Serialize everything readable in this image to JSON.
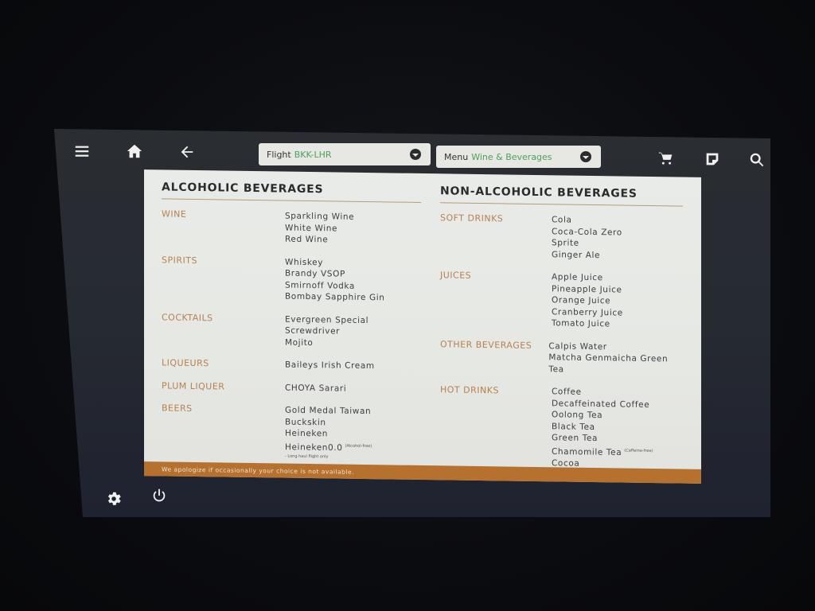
{
  "topbar": {
    "flight_dropdown": {
      "label": "Flight",
      "value": "BKK-LHR"
    },
    "menu_dropdown": {
      "label": "Menu",
      "value": "Wine & Beverages"
    },
    "icons": [
      "menu-icon",
      "home-icon",
      "back-arrow-icon",
      "cart-icon",
      "inbox-icon",
      "search-icon"
    ]
  },
  "alcoholic": {
    "title": "ALCOHOLIC BEVERAGES",
    "sections": [
      {
        "category": "WINE",
        "items": [
          "Sparkling Wine",
          "White Wine",
          "Red Wine"
        ]
      },
      {
        "category": "SPIRITS",
        "items": [
          "Whiskey",
          "Brandy VSOP",
          "Smirnoff Vodka",
          "Bombay Sapphire Gin"
        ]
      },
      {
        "category": "COCKTAILS",
        "items": [
          "Evergreen Special",
          "Screwdriver",
          "Mojito"
        ]
      },
      {
        "category": "LIQUEURS",
        "items": [
          "Baileys Irish Cream"
        ]
      },
      {
        "category": "PLUM LIQUER",
        "items": [
          "CHOYA Sarari"
        ]
      },
      {
        "category": "BEERS",
        "items": [
          "Gold Medal Taiwan",
          "Buckskin",
          "Heineken",
          "Heineken0.0"
        ],
        "item_note": "(Alcohol-free)",
        "footnote": "- Long haul flight only"
      }
    ]
  },
  "non_alcoholic": {
    "title": "NON-ALCOHOLIC BEVERAGES",
    "sections": [
      {
        "category": "SOFT DRINKS",
        "items": [
          "Cola",
          "Coca-Cola Zero",
          "Sprite",
          "Ginger Ale"
        ]
      },
      {
        "category": "JUICES",
        "items": [
          "Apple Juice",
          "Pineapple Juice",
          "Orange Juice",
          "Cranberry Juice",
          "Tomato Juice"
        ]
      },
      {
        "category": "OTHER BEVERAGES",
        "items": [
          "Calpis Water",
          "Matcha Genmaicha Green Tea"
        ]
      },
      {
        "category": "HOT DRINKS",
        "items": [
          "Coffee",
          "Decaffeinated Coffee",
          "Oolong Tea",
          "Black Tea",
          "Green Tea",
          "Chamomile Tea",
          "Cocoa"
        ],
        "item_note": "(Caffeine-free)"
      }
    ]
  },
  "footer": {
    "text": "We apologize if occasionally your choice is not available."
  },
  "bottombar": {
    "icons": [
      "settings-icon",
      "power-icon"
    ]
  },
  "colors": {
    "accent": "#b5712d",
    "category_text": "#b9804f",
    "dropdown_value": "#4aa35a",
    "panel_bg": "#e8e9e6",
    "screen_bg": "#282c31"
  }
}
